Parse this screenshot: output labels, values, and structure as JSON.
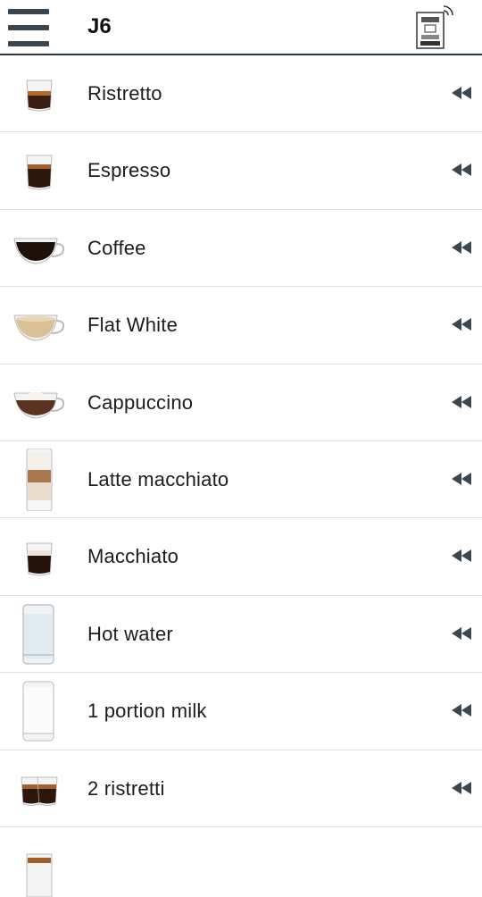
{
  "header": {
    "title": "J6",
    "menu_icon": "hamburger-menu-icon",
    "device_icon": "coffee-machine-wifi-icon"
  },
  "colors": {
    "header_rule": "#2b3a45",
    "icon_dark": "#3a4650",
    "divider": "#e2e2e2"
  },
  "products": [
    {
      "label": "Ristretto",
      "icon": "ristretto-glass-icon",
      "action_icon": "rewind-icon"
    },
    {
      "label": "Espresso",
      "icon": "espresso-glass-icon",
      "action_icon": "rewind-icon"
    },
    {
      "label": "Coffee",
      "icon": "coffee-cup-icon",
      "action_icon": "rewind-icon"
    },
    {
      "label": "Flat White",
      "icon": "flat-white-cup-icon",
      "action_icon": "rewind-icon"
    },
    {
      "label": "Cappuccino",
      "icon": "cappuccino-cup-icon",
      "action_icon": "rewind-icon"
    },
    {
      "label": "Latte macchiato",
      "icon": "latte-macchiato-glass-icon",
      "action_icon": "rewind-icon"
    },
    {
      "label": "Macchiato",
      "icon": "macchiato-glass-icon",
      "action_icon": "rewind-icon"
    },
    {
      "label": "Hot water",
      "icon": "hot-water-glass-icon",
      "action_icon": "rewind-icon"
    },
    {
      "label": "1 portion milk",
      "icon": "milk-glass-icon",
      "action_icon": "rewind-icon"
    },
    {
      "label": "2 ristretti",
      "icon": "two-ristretti-glasses-icon",
      "action_icon": "rewind-icon"
    }
  ]
}
